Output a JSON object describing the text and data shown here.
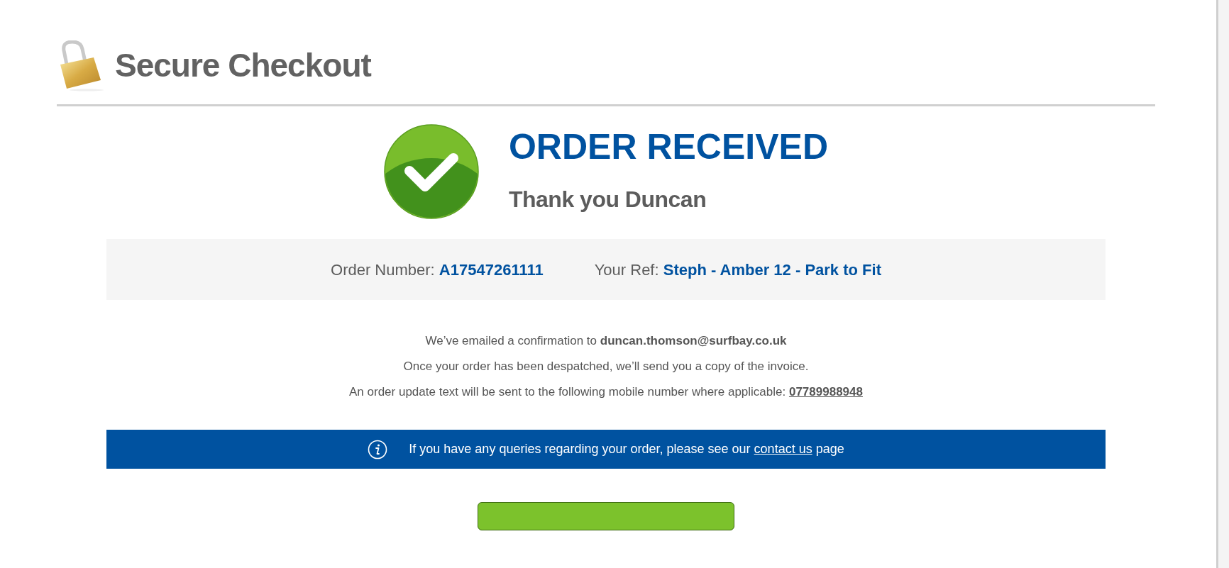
{
  "header": {
    "title": "Secure Checkout"
  },
  "confirmation": {
    "title": "ORDER RECEIVED",
    "subtitle": "Thank you Duncan"
  },
  "order_bar": {
    "items": [
      {
        "label": "Order Number:",
        "value": "A17547261111"
      },
      {
        "label": "Your Ref:",
        "value": "Steph - Amber 12 - Park to Fit"
      }
    ]
  },
  "messages": [
    {
      "text": "We’ve emailed a confirmation to **duncan.thomson@surfbay.co.uk**"
    },
    {
      "text": "Once your order has been despatched, we’ll send you a copy of the invoice."
    },
    {
      "text": "An order update text will be sent to the following mobile number where applicable:",
      "link": "07789988948"
    }
  ],
  "info_bar": {
    "text_before": "If you have any queries regarding your order, please see our",
    "link": "contact us",
    "text_after": "page"
  }
}
